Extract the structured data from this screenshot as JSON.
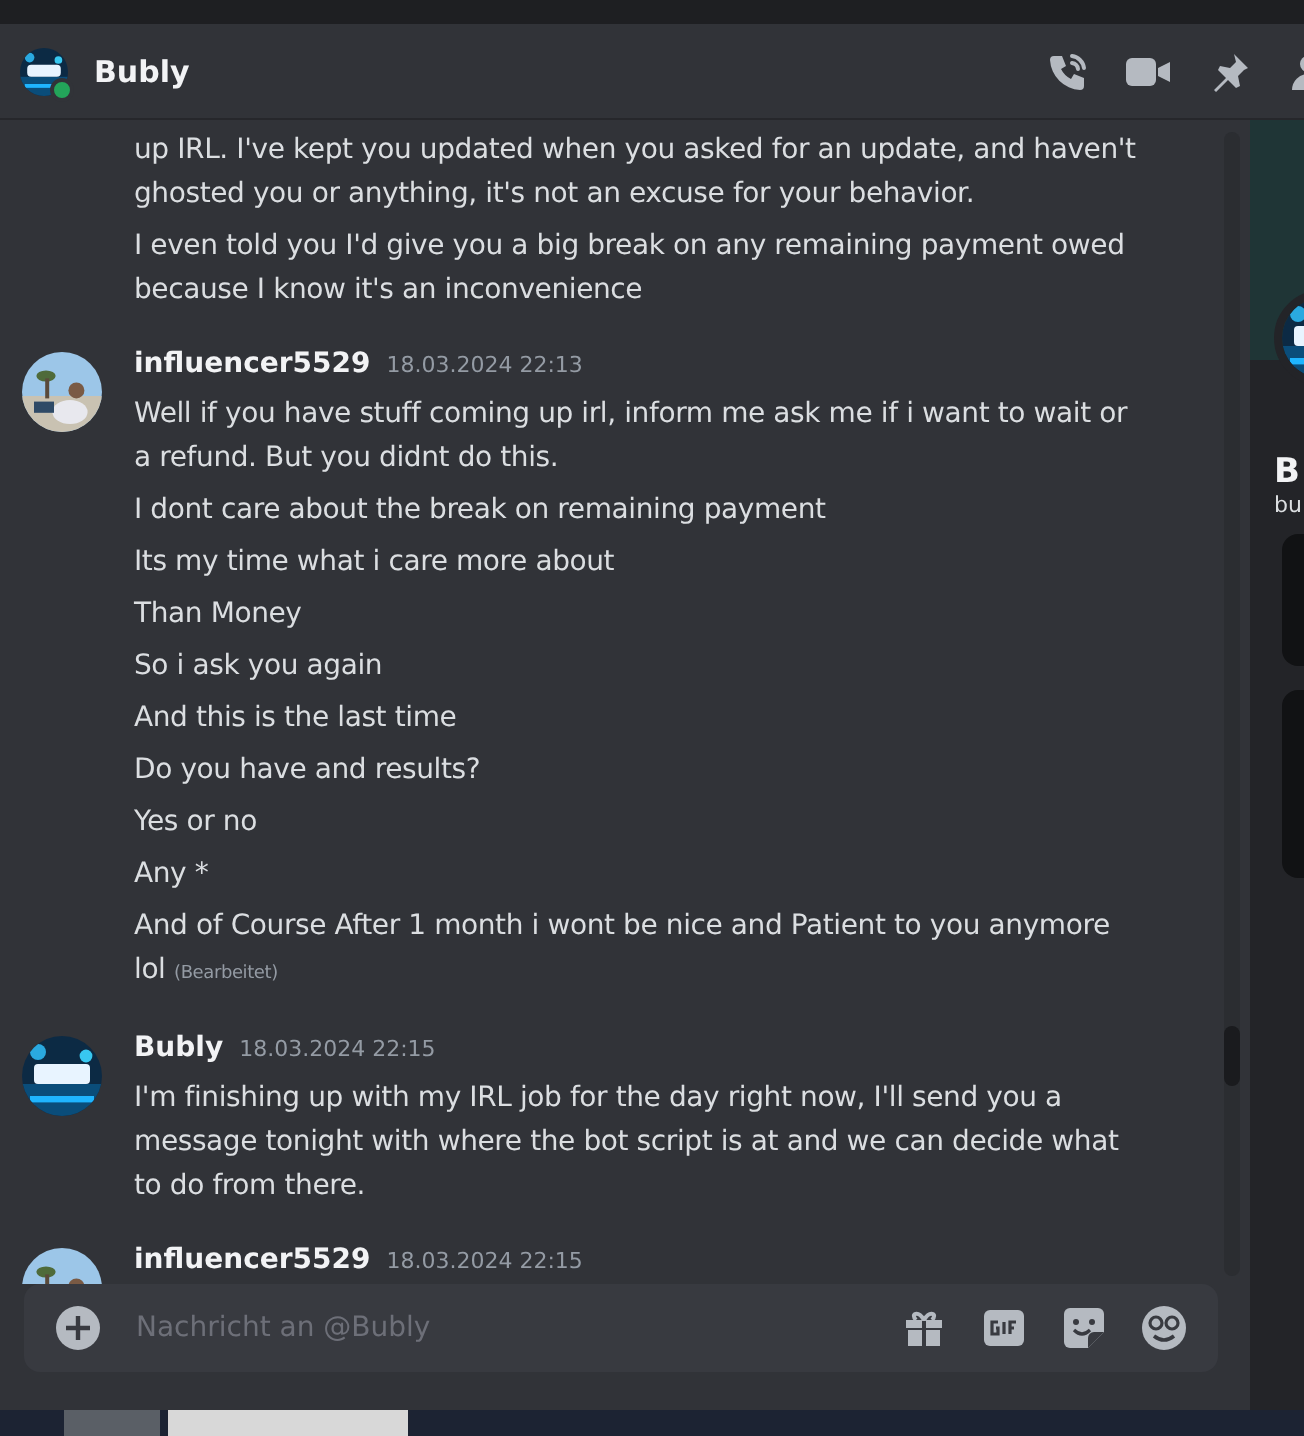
{
  "header": {
    "title": "Bubly",
    "online": true
  },
  "messages": [
    {
      "paragraphs": [
        "up IRL. I've kept you updated when you asked for an update, and haven't ghosted you or anything, it's not an excuse for your behavior.",
        "I even told you I'd give you a big break on any remaining payment owed because I know it's an inconvenience"
      ]
    },
    {
      "author": "influencer5529",
      "time": "18.03.2024 22:13",
      "paragraphs": [
        "Well if you have stuff coming up irl, inform me ask me if i want to wait or a refund. But you didnt do this.",
        "I dont care about the break on remaining payment",
        "Its my time what i care more about",
        "Than Money",
        "So i ask you again",
        "And this is the last time",
        "Do you have and results?",
        "Yes or no",
        "Any *",
        "And of Course After 1 month i wont be nice and Patient to you anymore lol"
      ],
      "edited_label": "(Bearbeitet)"
    },
    {
      "author": "Bubly",
      "time": "18.03.2024 22:15",
      "paragraphs": [
        "I'm finishing up with my IRL job for the day right now, I'll send you a message tonight with where the bot script is at and we can decide what to do from there."
      ]
    },
    {
      "author": "influencer5529",
      "time": "18.03.2024 22:15"
    }
  ],
  "composer": {
    "placeholder": "Nachricht an @Bubly"
  },
  "profile_panel": {
    "name": "B",
    "username": "bu"
  }
}
